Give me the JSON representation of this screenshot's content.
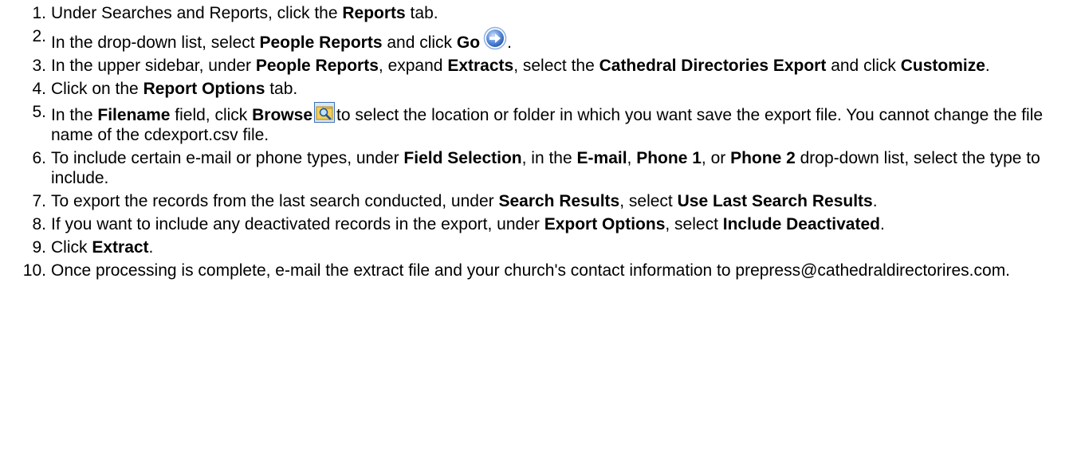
{
  "steps": [
    {
      "num": "1.",
      "parts": [
        {
          "t": "Under Searches and Reports, click the "
        },
        {
          "t": "Reports",
          "b": true
        },
        {
          "t": " tab."
        }
      ]
    },
    {
      "num": "2.",
      "parts": [
        {
          "t": "In the drop-down list, select "
        },
        {
          "t": "People Reports",
          "b": true
        },
        {
          "t": " and click "
        },
        {
          "t": "Go",
          "b": true
        },
        {
          "icon": "go-arrow-icon"
        },
        {
          "t": "."
        }
      ]
    },
    {
      "num": "3.",
      "parts": [
        {
          "t": "In the upper sidebar, under "
        },
        {
          "t": "People Reports",
          "b": true
        },
        {
          "t": ", expand "
        },
        {
          "t": "Extracts",
          "b": true
        },
        {
          "t": ", select the "
        },
        {
          "t": "Cathedral Directories Export",
          "b": true
        },
        {
          "t": " and click "
        },
        {
          "t": "Customize",
          "b": true
        },
        {
          "t": "."
        }
      ]
    },
    {
      "num": "4.",
      "parts": [
        {
          "t": "Click on the "
        },
        {
          "t": "Report Options",
          "b": true
        },
        {
          "t": " tab."
        }
      ]
    },
    {
      "num": "5.",
      "parts": [
        {
          "t": "In the "
        },
        {
          "t": "Filename",
          "b": true
        },
        {
          "t": " field, click "
        },
        {
          "t": "Browse",
          "b": true
        },
        {
          "icon": "browse-folder-icon"
        },
        {
          "t": "to select the location or folder in which you want save the export file. You cannot change the file name of the cdexport.csv file."
        }
      ]
    },
    {
      "num": "6.",
      "parts": [
        {
          "t": "To include certain e-mail or phone types, under "
        },
        {
          "t": "Field Selection",
          "b": true
        },
        {
          "t": ", in the "
        },
        {
          "t": "E-mail",
          "b": true
        },
        {
          "t": ", "
        },
        {
          "t": "Phone 1",
          "b": true
        },
        {
          "t": ", or "
        },
        {
          "t": "Phone 2",
          "b": true
        },
        {
          "t": " drop-down list, select the type to include."
        }
      ]
    },
    {
      "num": "7.",
      "parts": [
        {
          "t": "To export the records from the last search conducted, under "
        },
        {
          "t": "Search Results",
          "b": true
        },
        {
          "t": ", select "
        },
        {
          "t": "Use Last Search Results",
          "b": true
        },
        {
          "t": "."
        }
      ]
    },
    {
      "num": "8.",
      "parts": [
        {
          "t": "If you want to include any deactivated records in the export, under "
        },
        {
          "t": "Export Options",
          "b": true
        },
        {
          "t": ", select "
        },
        {
          "t": "Include Deactivated",
          "b": true
        },
        {
          "t": "."
        }
      ]
    },
    {
      "num": "9.",
      "parts": [
        {
          "t": "Click "
        },
        {
          "t": "Extract",
          "b": true
        },
        {
          "t": "."
        }
      ]
    },
    {
      "num": "10.",
      "parts": [
        {
          "t": "Once processing is complete, e-mail the extract file and your church's contact information to prepress@cathedraldirectorires.com."
        }
      ]
    }
  ],
  "colors": {
    "go_icon_fill": "#4a7fd4",
    "go_icon_ring": "#9fc0ee",
    "browse_icon_bg": "#f3d56a",
    "browse_icon_border": "#3b6fb6"
  }
}
